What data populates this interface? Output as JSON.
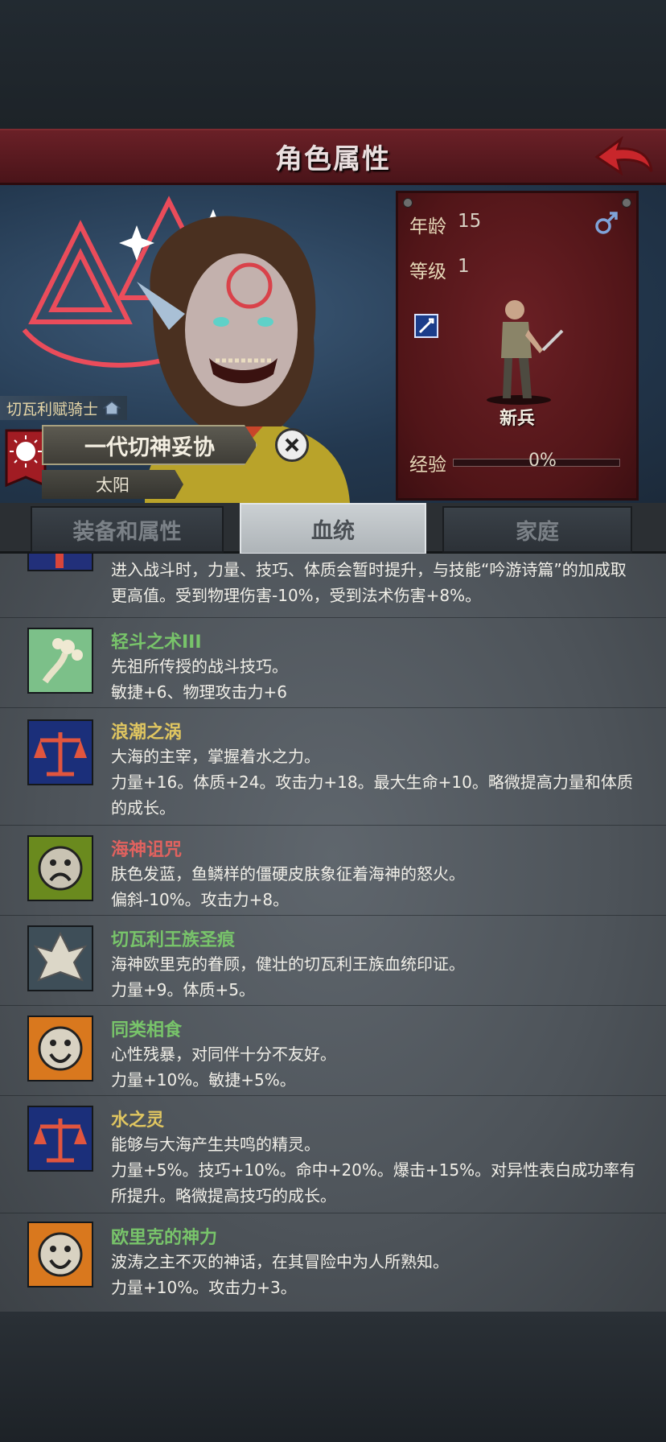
{
  "header": {
    "title": "角色属性"
  },
  "character": {
    "class_label": "切瓦利赋骑士",
    "name": "一代切神妥协",
    "deity": "太阳"
  },
  "stats": {
    "age_label": "年龄",
    "age_value": "15",
    "level_label": "等级",
    "level_value": "1",
    "unit_label": "新兵",
    "exp_label": "经验",
    "exp_value": "0%",
    "exp_fraction": 0
  },
  "tabs": [
    {
      "label": "装备和属性",
      "active": false
    },
    {
      "label": "血统",
      "active": true
    },
    {
      "label": "家庭",
      "active": false
    }
  ],
  "traits": [
    {
      "name": "",
      "desc": "进入战斗时，力量、技巧、体质会暂时提升，与技能“吟游诗篇”的加成取更高值。受到物理伤害-10%，受到法术伤害+8%。",
      "effect": "",
      "name_color": "yellow",
      "icon": "partial-red-icon"
    },
    {
      "name": "轻斗之术III",
      "desc": "先祖所传授的战斗技巧。",
      "effect": "敏捷+6、物理攻击力+6",
      "name_color": "green",
      "icon": "hand-flower-icon"
    },
    {
      "name": "浪潮之涡",
      "desc": "大海的主宰，掌握着水之力。",
      "effect": "力量+16。体质+24。攻击力+18。最大生命+10。略微提高力量和体质的成长。",
      "name_color": "yellow",
      "icon": "scales-icon"
    },
    {
      "name": "海神诅咒",
      "desc": "肤色发蓝，鱼鳞样的僵硬皮肤象征着海神的怒火。",
      "effect": "偏斜-10%。攻击力+8。",
      "name_color": "red",
      "icon": "sad-face-icon"
    },
    {
      "name": "切瓦利王族圣痕",
      "desc": "海神欧里克的眷顾，健壮的切瓦利王族血统印证。",
      "effect": "力量+9。体质+5。",
      "name_color": "green",
      "icon": "crest-icon"
    },
    {
      "name": "同类相食",
      "desc": "心性残暴，对同伴十分不友好。",
      "effect": "力量+10%。敏捷+5%。",
      "name_color": "green",
      "icon": "happy-face-icon"
    },
    {
      "name": "水之灵",
      "desc": "能够与大海产生共鸣的精灵。",
      "effect": "力量+5%。技巧+10%。命中+20%。爆击+15%。对异性表白成功率有所提升。略微提高技巧的成长。",
      "name_color": "yellow",
      "icon": "scales-icon"
    },
    {
      "name": "欧里克的神力",
      "desc": "波涛之主不灭的神话，在其冒险中为人所熟知。",
      "effect": "力量+10%。攻击力+3。",
      "name_color": "green",
      "icon": "happy-face-icon"
    }
  ]
}
